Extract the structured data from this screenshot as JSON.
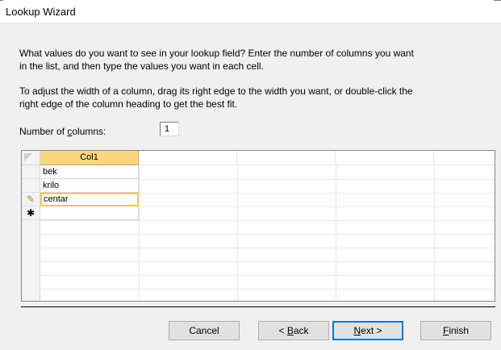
{
  "window": {
    "title": "Lookup Wizard"
  },
  "instructions": {
    "p1_line1": "What values do you want to see in your lookup field? Enter the number of columns you want",
    "p1_line2": "in the list, and then type the values you want in each cell.",
    "p2_line1": "To adjust the width of a column, drag its right edge to the width you want, or double-click the",
    "p2_line2": "right edge of the column heading to get the best fit."
  },
  "columns": {
    "label_before": "Number of ",
    "label_hotkey": "c",
    "label_after": "olumns:",
    "value": "1"
  },
  "grid": {
    "header": "Col1",
    "rows": [
      "bek",
      "krilo",
      "centar",
      ""
    ],
    "edit_marker": "✎",
    "new_marker": "✱"
  },
  "buttons": {
    "cancel": "Cancel",
    "back_prefix": "< ",
    "back_hotkey": "B",
    "back_rest": "ack",
    "next_hotkey": "N",
    "next_rest": "ext >",
    "finish_hotkey": "F",
    "finish_rest": "inish"
  }
}
